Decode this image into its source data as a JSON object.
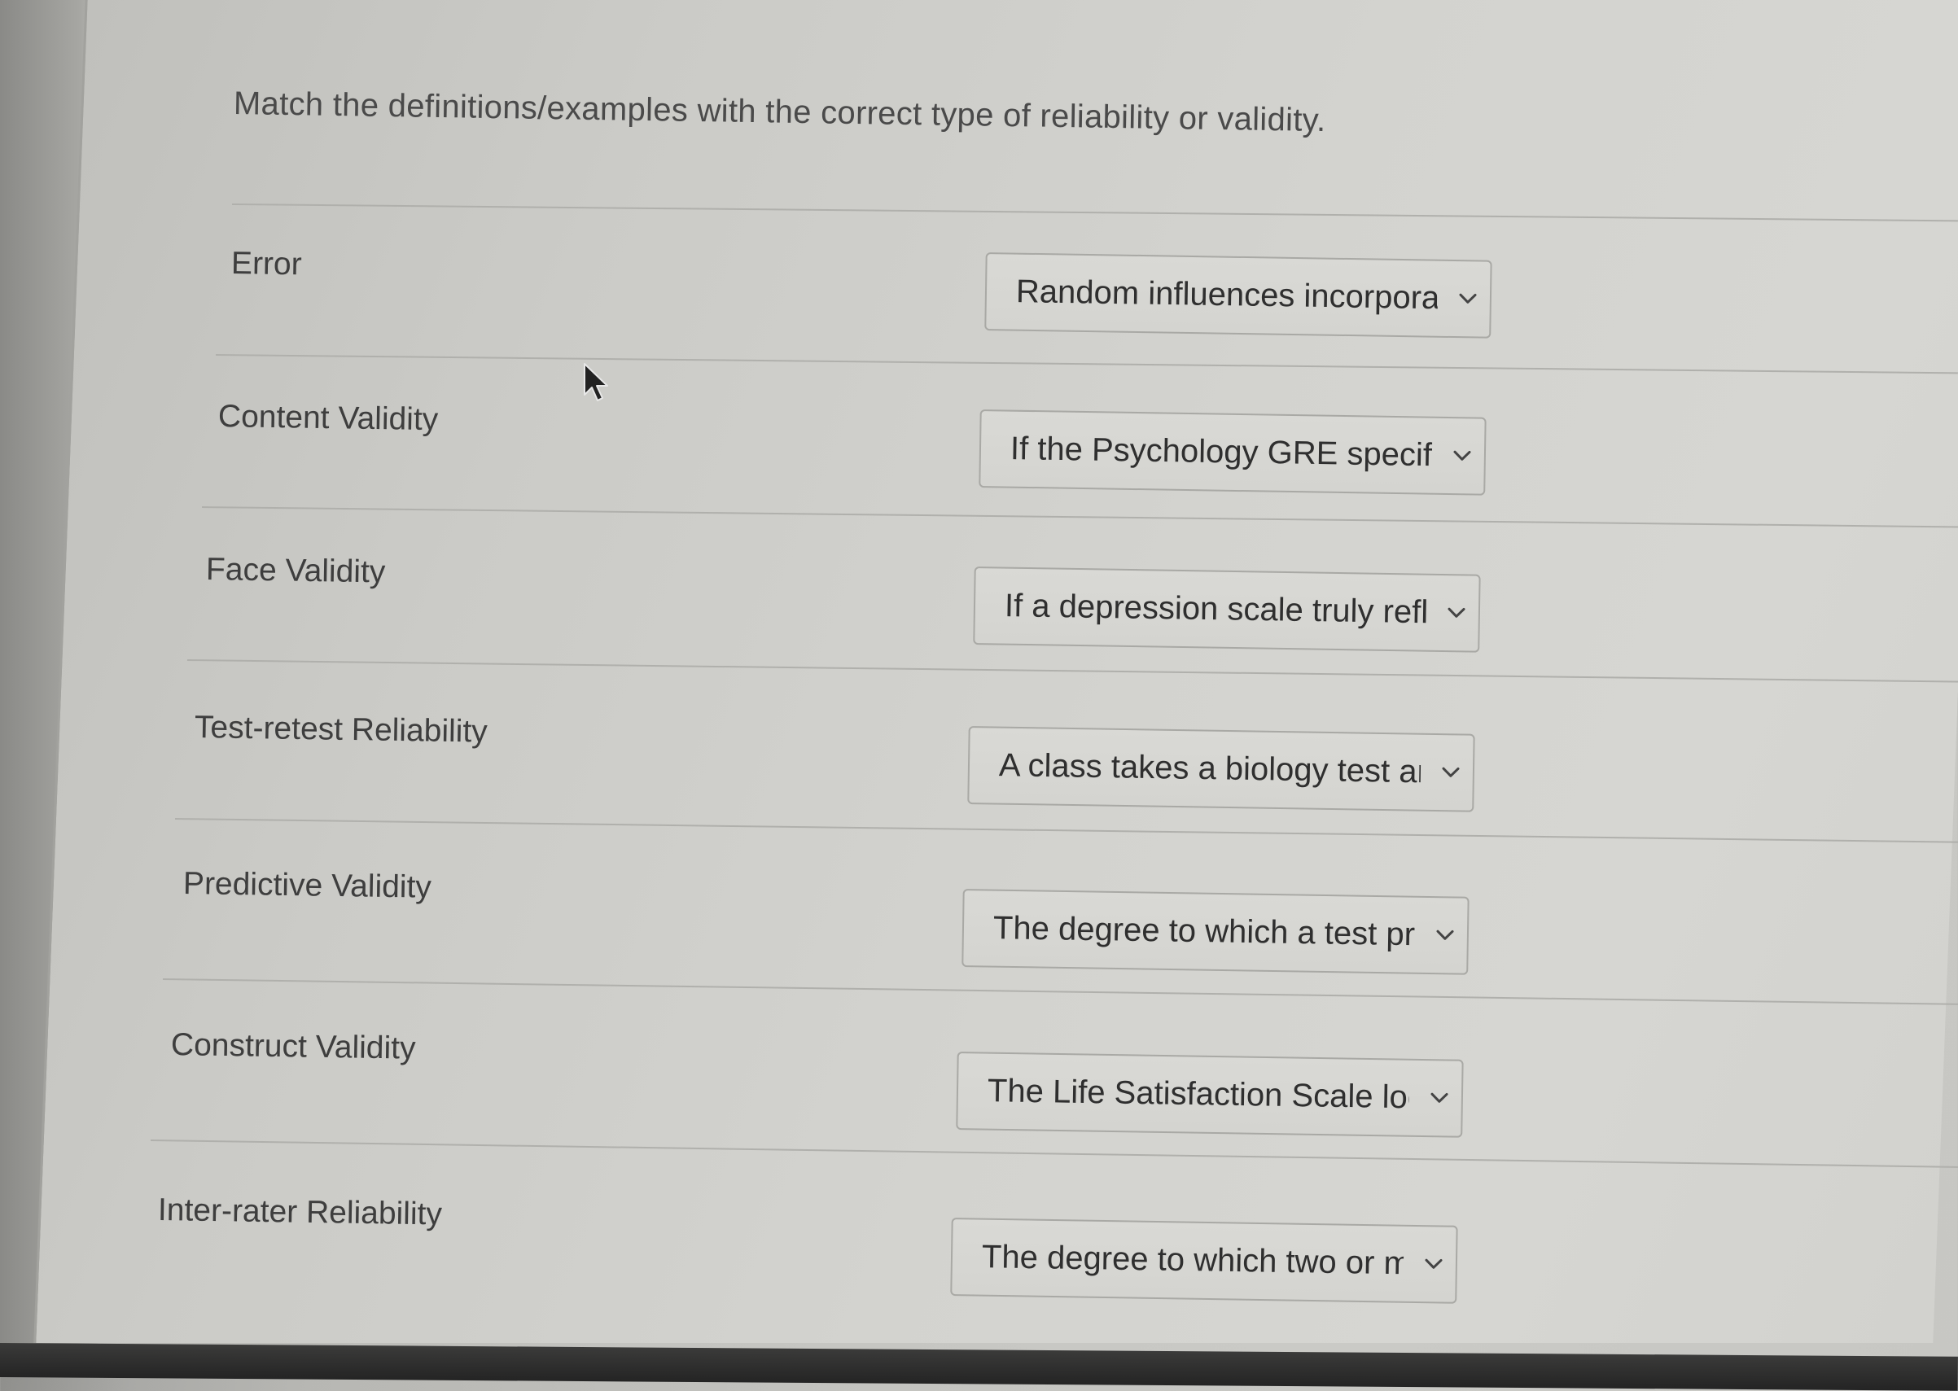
{
  "question": {
    "text": "Match the definitions/examples with the correct type of reliability or validity."
  },
  "items": [
    {
      "term": "Error",
      "selected": "Random influences incorporat"
    },
    {
      "term": "Content Validity",
      "selected": "If the Psychology GRE specific"
    },
    {
      "term": "Face Validity",
      "selected": "If a depression scale truly refle"
    },
    {
      "term": "Test-retest Reliability",
      "selected": "A class takes a biology test an"
    },
    {
      "term": "Predictive Validity",
      "selected": "The degree to which a test pre"
    },
    {
      "term": "Construct Validity",
      "selected": "The Life Satisfaction Scale loo"
    },
    {
      "term": "Inter-rater Reliability",
      "selected": "The degree to which two or m"
    }
  ],
  "icons": {
    "dropdown": "chevron-down-icon",
    "pointer": "mouse-pointer-icon"
  }
}
